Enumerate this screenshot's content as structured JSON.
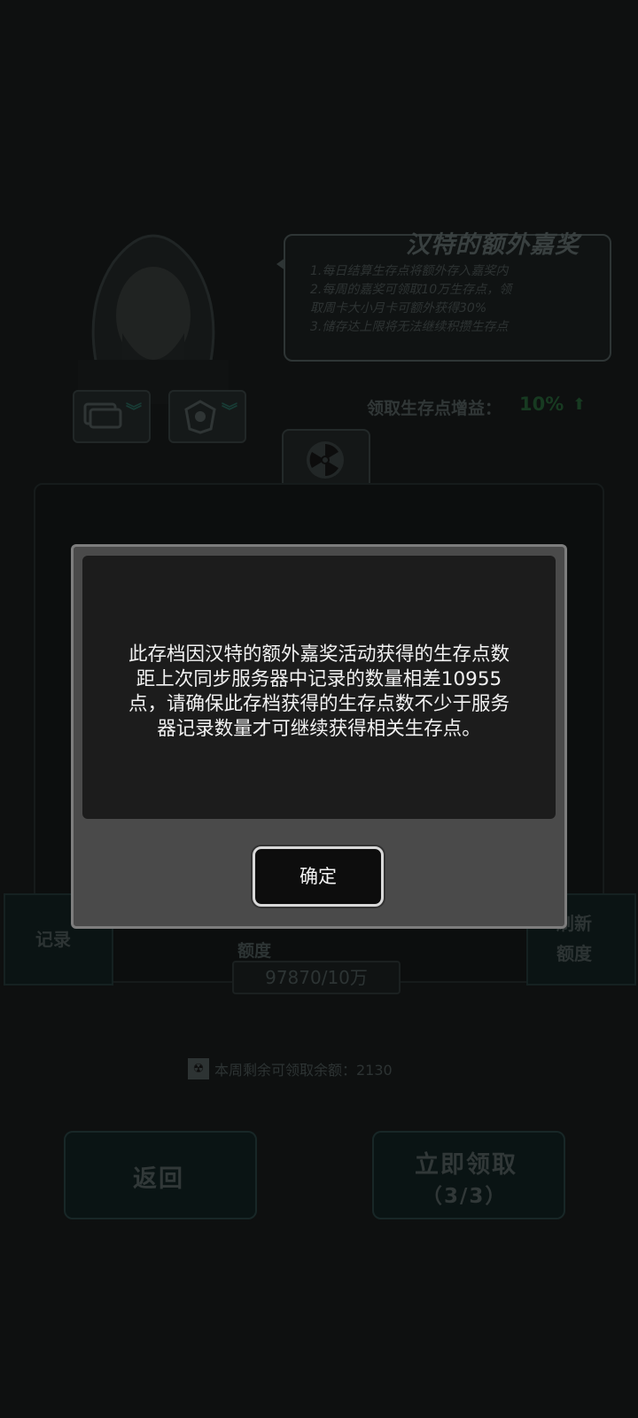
{
  "event": {
    "title": "汉特的额外嘉奖",
    "rules": [
      "1.每日结算生存点将额外存入嘉奖内",
      "2.每周的嘉奖可领取10万生存点，领",
      "取周卡大小月卡可额外获得30%",
      "3.储存达上限将无法继续积攒生存点"
    ],
    "bonus_label": "领取生存点增益：",
    "bonus_value": "10%",
    "bonus_arrow": "⬆"
  },
  "panel": {
    "record_label": "记录",
    "refresh_label_1": "刷新",
    "refresh_label_2": "额度",
    "quota_label": "额度",
    "quota_value": "97870/10万",
    "weekly_remaining": "本周剩余可领取余额：2130"
  },
  "bottom": {
    "back_label": "返回",
    "claim_label": "立即领取",
    "claim_count": "（3/3）"
  },
  "dialog": {
    "lines": [
      "此存档因汉特的额外嘉奖活动获得的生存点数",
      "距上次同步服务器中记录的数量相差10955",
      "点，请确保此存档获得的生存点数不少于服务",
      "器记录数量才可继续获得相关生存点。"
    ],
    "ok_label": "确定"
  }
}
